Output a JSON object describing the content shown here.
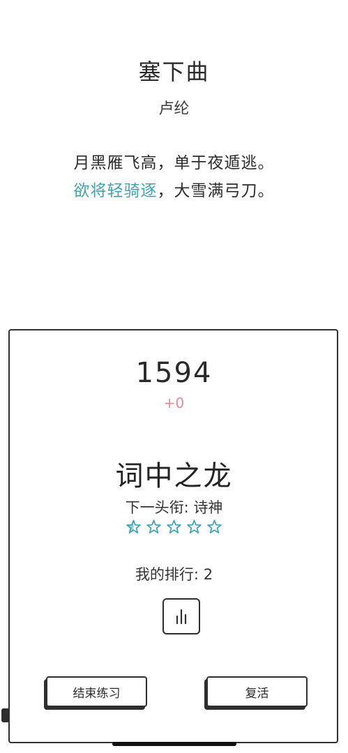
{
  "poem": {
    "title": "塞下曲",
    "author": "卢纶",
    "line1": "月黑雁飞高，单于夜遁逃。",
    "line2_highlight": "欲将轻骑逐",
    "line2_rest": "，大雪满弓刀。"
  },
  "result": {
    "score": "1594",
    "delta": "+0",
    "rank_title": "词中之龙",
    "next_title": "下一头衔: 诗神",
    "stars_total": 5,
    "stars_filled_fraction": 0.1,
    "my_rank": "我的排行: 2"
  },
  "buttons": {
    "end_practice": "结束练习",
    "revive": "复活"
  },
  "colors": {
    "highlight": "#3fa3b3",
    "delta": "#e28a99",
    "star": "#3fa3b3",
    "ink": "#2e2e2e"
  },
  "icons": {
    "chart": "bar-chart-icon",
    "star": "star-outline-icon"
  }
}
